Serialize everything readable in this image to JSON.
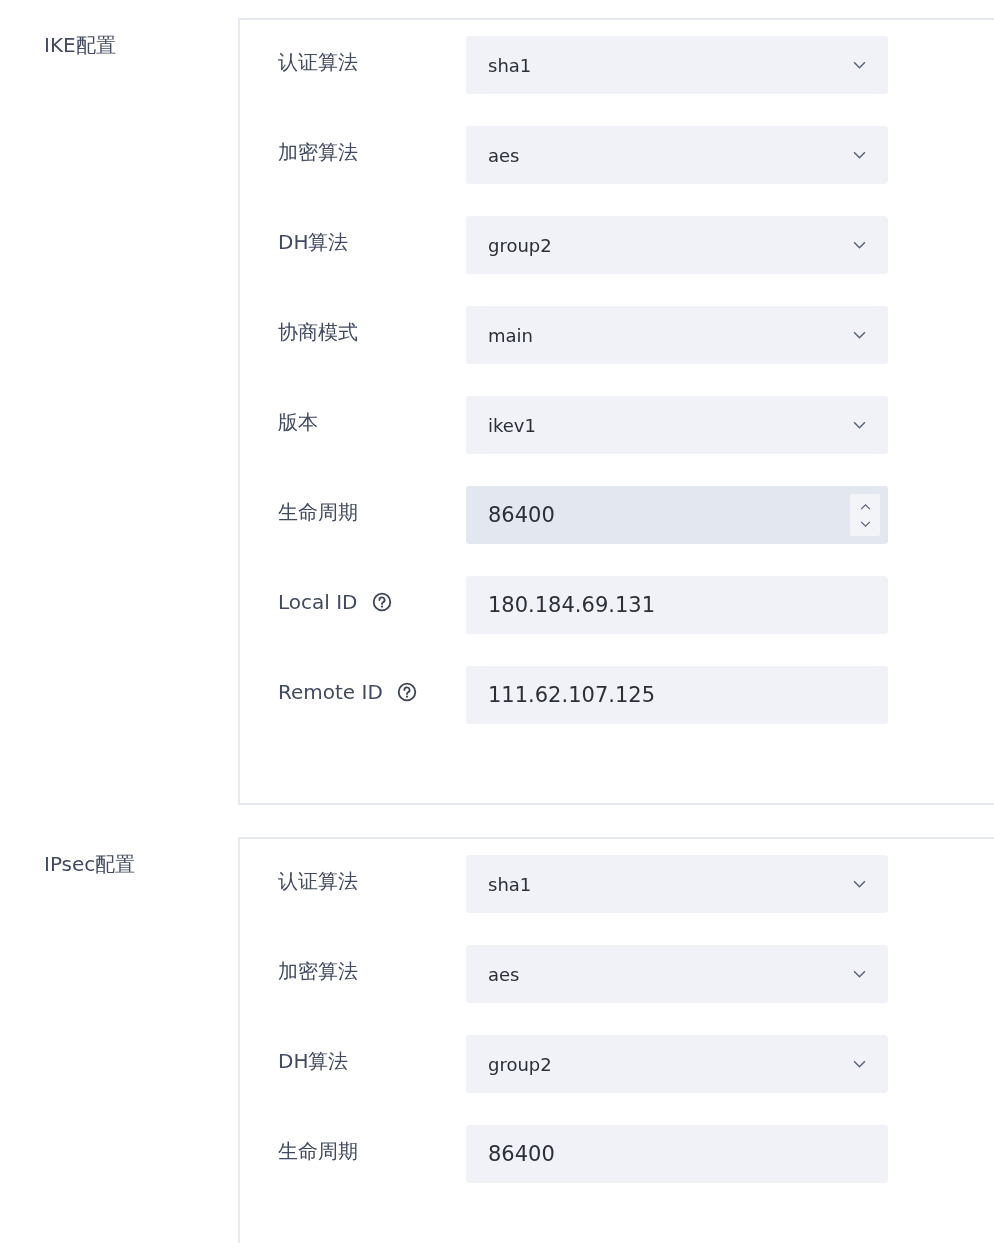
{
  "sections": [
    {
      "title": "IKE配置",
      "closed": true,
      "fields": [
        {
          "label": "认证算法",
          "kind": "select",
          "value": "sha1"
        },
        {
          "label": "加密算法",
          "kind": "select",
          "value": "aes"
        },
        {
          "label": "DH算法",
          "kind": "select",
          "value": "group2"
        },
        {
          "label": "协商模式",
          "kind": "select",
          "value": "main"
        },
        {
          "label": "版本",
          "kind": "select",
          "value": "ikev1"
        },
        {
          "label": "生命周期",
          "kind": "number",
          "value": "86400",
          "hovered": true
        },
        {
          "label": "Local ID",
          "kind": "text",
          "value": "180.184.69.131",
          "help": true
        },
        {
          "label": "Remote ID",
          "kind": "text",
          "value": "111.62.107.125",
          "help": true
        }
      ]
    },
    {
      "title": "IPsec配置",
      "closed": false,
      "fields": [
        {
          "label": "认证算法",
          "kind": "select",
          "value": "sha1"
        },
        {
          "label": "加密算法",
          "kind": "select",
          "value": "aes"
        },
        {
          "label": "DH算法",
          "kind": "select",
          "value": "group2"
        },
        {
          "label": "生命周期",
          "kind": "text",
          "value": "86400"
        }
      ]
    }
  ]
}
